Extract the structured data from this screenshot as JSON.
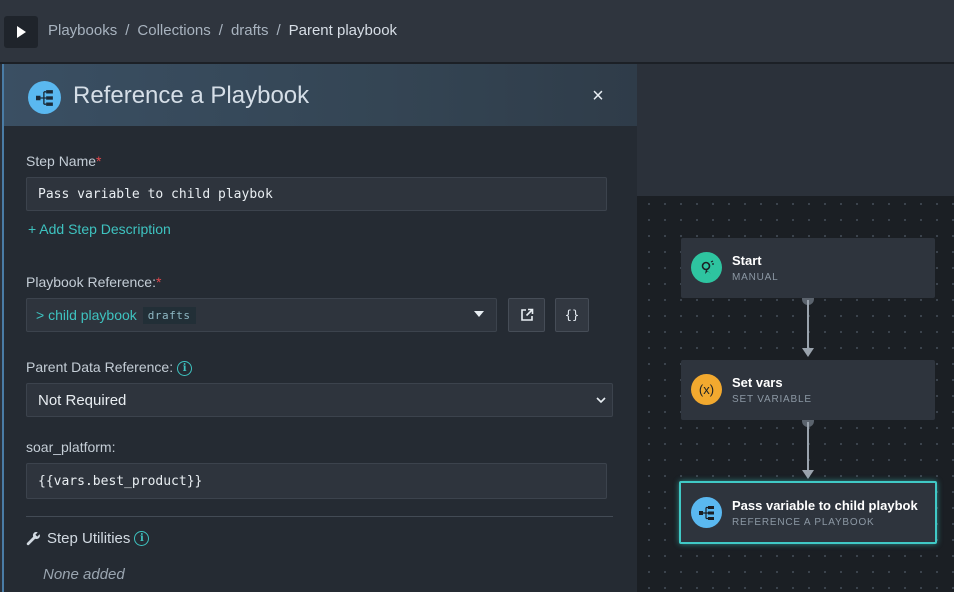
{
  "breadcrumb": [
    "Playbooks",
    "Collections",
    "drafts"
  ],
  "breadcrumb_current": "Parent playbook",
  "panel": {
    "title": "Reference a Playbook",
    "close": "×",
    "step_name_label": "Step Name",
    "step_name_value": "Pass variable to child playbok",
    "add_description": "+ Add Step Description",
    "playbook_ref_label": "Playbook Reference:",
    "playbook_ref_value": "> child playbook",
    "playbook_ref_badge": "drafts",
    "json_btn": "{}",
    "parent_data_label": "Parent Data Reference:",
    "parent_data_value": "Not Required",
    "param_label": "soar_platform:",
    "param_value": "{{vars.best_product}}",
    "utilities_label": "Step Utilities",
    "utilities_empty": "None added",
    "required_mark": "*"
  },
  "nodes": [
    {
      "title": "Start",
      "sub": "MANUAL",
      "color": "#2ec4a0"
    },
    {
      "title": "Set vars",
      "sub": "SET VARIABLE",
      "color": "#f2a92f",
      "glyph": "(x)"
    },
    {
      "title": "Pass variable to child playbok",
      "sub": "REFERENCE A PLAYBOOK",
      "color": "#5ab8f0"
    }
  ],
  "colors": {
    "accent": "#3ec3c0",
    "required": "#e0474c",
    "selected_border": "#40c9c6"
  }
}
